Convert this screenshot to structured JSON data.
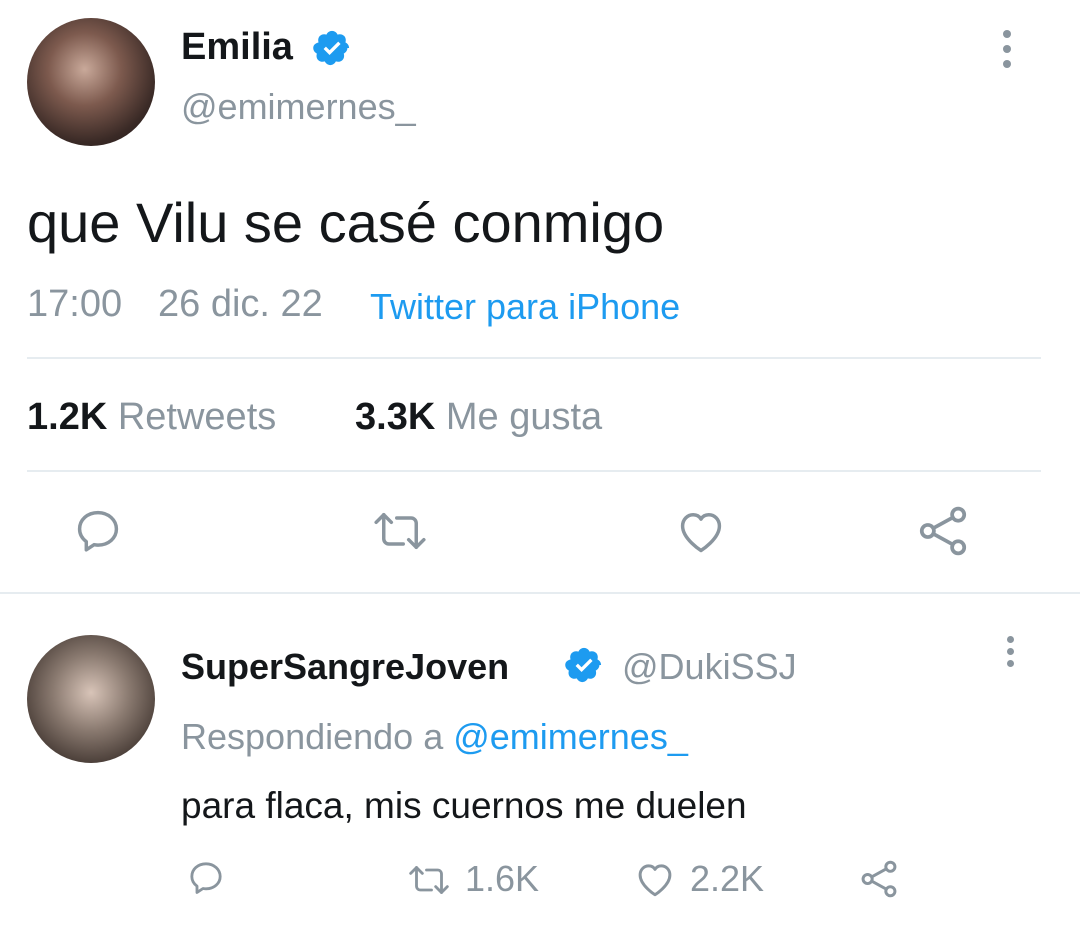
{
  "tweet": {
    "author_name": "Emilia",
    "author_handle": "@emimernes_",
    "text": "que Vilu se casé conmigo",
    "time": "17:00",
    "date": "26 dic. 22",
    "source": "Twitter para iPhone",
    "retweets_count": "1.2K",
    "retweets_label": "Retweets",
    "likes_count": "3.3K",
    "likes_label": "Me gusta"
  },
  "reply": {
    "author_name": "SuperSangreJoven",
    "author_handle": "@DukiSSJ",
    "replying_prefix": "Respondiendo a",
    "replying_to": "@emimernes_",
    "text": "para flaca, mis cuernos me duelen",
    "retweet_count": "1.6K",
    "like_count": "2.2K"
  },
  "colors": {
    "accent": "#1d9bf0",
    "muted": "#8a959e",
    "text": "#14171a",
    "divider": "#e6ecf0"
  },
  "icons": [
    "verified-badge-icon",
    "more-options-icon",
    "reply-icon",
    "retweet-icon",
    "like-icon",
    "share-icon"
  ]
}
